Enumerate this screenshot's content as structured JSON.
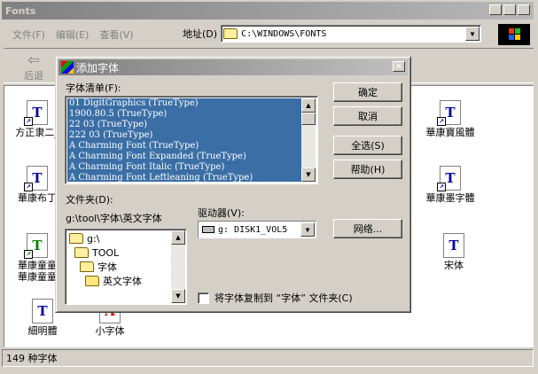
{
  "explorer": {
    "title": "Fonts",
    "menu": [
      "文件(F)",
      "编辑(E)",
      "查看(V)"
    ],
    "address_label": "地址(D)",
    "address_value": "C:\\WINDOWS\\FONTS",
    "back_label": "后退",
    "status_text": "149 种字体",
    "icons": [
      {
        "label": "方正隶二_",
        "glyph": "T",
        "color": "#0000a0"
      },
      {
        "label": "華康布丁",
        "glyph": "T",
        "color": "#0000a0"
      },
      {
        "label": "華康童童\n華康童童",
        "glyph": "T",
        "color": "#008000"
      },
      {
        "label": "細明體",
        "glyph": "T",
        "color": "#0000a0"
      },
      {
        "label": "小字体",
        "glyph": "A",
        "color": "#c00000"
      },
      {
        "label": "華康寶風體",
        "glyph": "T",
        "color": "#0000a0"
      },
      {
        "label": "華康墨字體",
        "glyph": "T",
        "color": "#0000a0"
      },
      {
        "label": "宋体",
        "glyph": "T",
        "color": "#0000a0"
      }
    ]
  },
  "dialog": {
    "title": "添加字体",
    "font_list_label": "字体清单(F):",
    "fonts": [
      "01 DigitGraphics (TrueType)",
      "1900.80.5 (TrueType)",
      "22 03 (TrueType)",
      "222 03 (TrueType)",
      "A Charming Font (TrueType)",
      "A Charming Font Expanded (TrueType)",
      "A Charming Font Italic (TrueType)",
      "A Charming Font Leftleaning (TrueType)"
    ],
    "buttons": {
      "ok": "确定",
      "cancel": "取消",
      "select_all": "全选(S)",
      "help": "帮助(H)",
      "network": "网络..."
    },
    "folder_label": "文件夹(D):",
    "folder_path": "g:\\tool\\字体\\英文字体",
    "tree": [
      "g:\\",
      "TOOL",
      "字体",
      "英文字体"
    ],
    "drive_label": "驱动器(V):",
    "drive_value": "g:  DISK1_VOL5",
    "copy_checkbox_label": "将字体复制到 “字体” 文件夹(C)",
    "copy_checked": false
  }
}
